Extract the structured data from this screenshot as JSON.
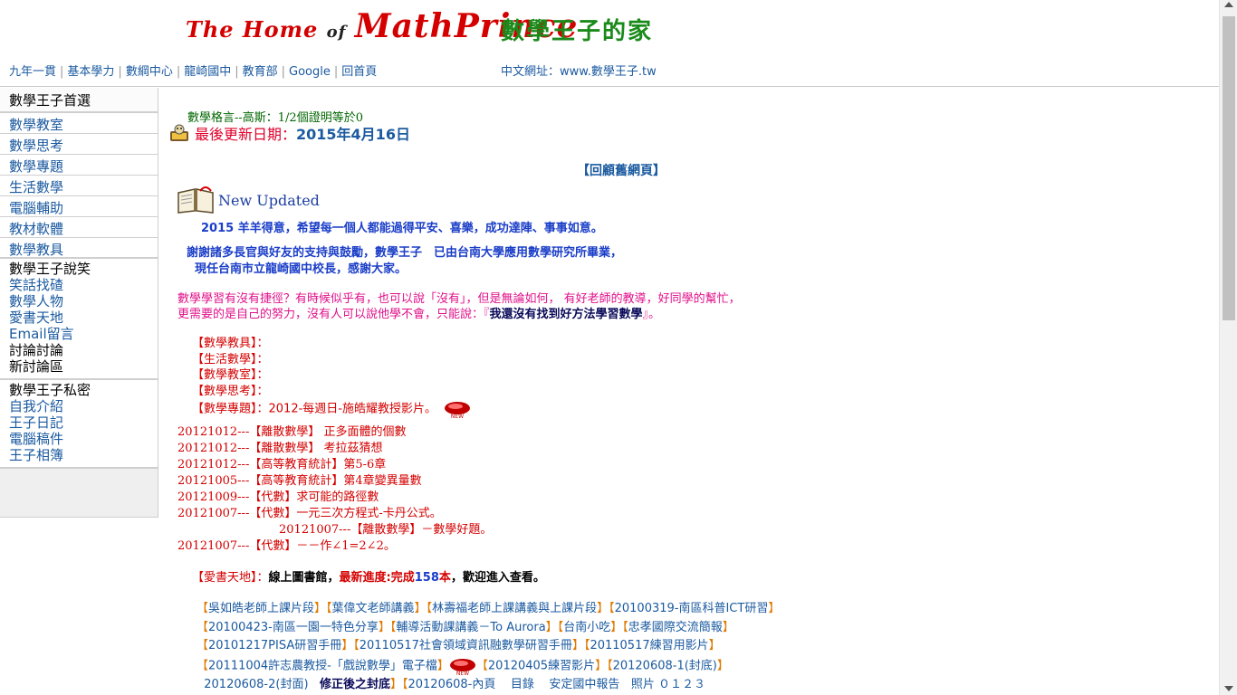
{
  "header": {
    "logo_en_1": "The Home",
    "logo_en_of": "of",
    "logo_en_2": "MathPrince",
    "logo_zh": "數學王子的家",
    "nav": [
      "九年一貫",
      "基本學力",
      "數綱中心",
      "龍崎國中",
      "教育部",
      "Google",
      "回首頁"
    ],
    "url_text": "中文網址：www.數學王子.tw"
  },
  "sidebar": {
    "home": "數學王子首選",
    "items": [
      "數學教室",
      "數學思考",
      "數學專題",
      "生活數學",
      "電腦輔助",
      "教材軟體",
      "數學教具"
    ],
    "block1_title": "數學王子說笑",
    "block1_links": [
      "笑話找碴",
      "數學人物",
      "愛書天地",
      "Email留言"
    ],
    "block1_extra": [
      "討論討論",
      "新討論區"
    ],
    "block2_title": "數學王子私密",
    "block2_links": [
      "自我介紹",
      "王子日記",
      "電腦稿件",
      "王子相簿"
    ]
  },
  "main": {
    "motto": "數學格言--高斯：1/2個證明等於0",
    "update_label": "最後更新日期：",
    "update_date": "2015年4月16日",
    "review": "【回顧舊網頁】",
    "new_updated": "New Updated",
    "greeting": "2015 羊羊得意，希望每一個人都能過得平安、喜樂，成功達陣、事事如意。",
    "thanks_1": "謝謝諸多長官與好友的支持與鼓勵，數學王子　已由台南大學應用數學研究所畢業，",
    "thanks_2": "現任台南市立龍崎國中校長，感謝大家。",
    "pink_1": "數學學習有沒有捷徑？有時候似乎有，也可以說「沒有」，但是無論如何， 有好老師的教導，好同學的幫忙，",
    "pink_2a": "更需要的是自己的努力，沒有人可以說他學不會，只能說：『",
    "pink_2b": "我還沒有找到好方法學習數學",
    "pink_2c": "』。",
    "categories": [
      "【數學教具】：",
      "【生活數學】：",
      "【數學教室】：",
      "【數學思考】："
    ],
    "topic": "【數學專題】：2012-每週日-施皓耀教授影片。",
    "dated": [
      "20121012---【離散數學】 正多面體的個數",
      "20121012---【離散數學】  考拉茲猜想",
      "20121012---【高等教育統計】第5-6章",
      "20121005---【高等教育統計】第4章變異量數",
      "20121009---【代數】求可能的路徑數",
      "20121007---【代數】一元三次方程式-卡丹公式。",
      "20121007---【離散數學】－數學好題。",
      "20121007---【代數】－－作∠1=2∠2。"
    ],
    "books_label": "【愛書天地】：",
    "books_text1": "線上圖書館，",
    "books_text2": "最新進度:完成",
    "books_num": "158",
    "books_text3": "本",
    "books_text4": "，歡迎進入查看。",
    "links_row1": [
      "吳如皓老師上課片段",
      "葉偉文老師講義",
      "林壽福老師上課講義與上課片段",
      "20100319-南區科普ICT研習"
    ],
    "links_row2": [
      "20100423-南區一園一特色分享",
      "輔導活動課講義－To Aurora",
      "台南小吃",
      "忠孝國際交流簡報"
    ],
    "links_row3": [
      "20101217PISA研習手冊",
      "20110517社會領域資訊融數學研習手冊",
      "20110517練習用影片"
    ],
    "links_row4": [
      "20111004許志農教授-「戲說數學」電子檔",
      "20120405練習影片",
      "20120608-1(封底)"
    ],
    "links_row5_a": "20120608-2(封面)",
    "links_row5_b": "修正後之封底",
    "links_row5_c": "20120608-內頁",
    "links_row5_d": "目錄",
    "links_row5_e": "安定國中報告",
    "links_row5_f": "照片",
    "links_row5_g": "０１２３"
  },
  "colors": {
    "link_blue": "#1b5aa0",
    "red": "#d40000",
    "pink": "#e0108a",
    "green": "#1a8a1a",
    "orange": "#e07a00"
  },
  "icons": [
    "update-icon",
    "book-icon",
    "new-tag-icon"
  ]
}
